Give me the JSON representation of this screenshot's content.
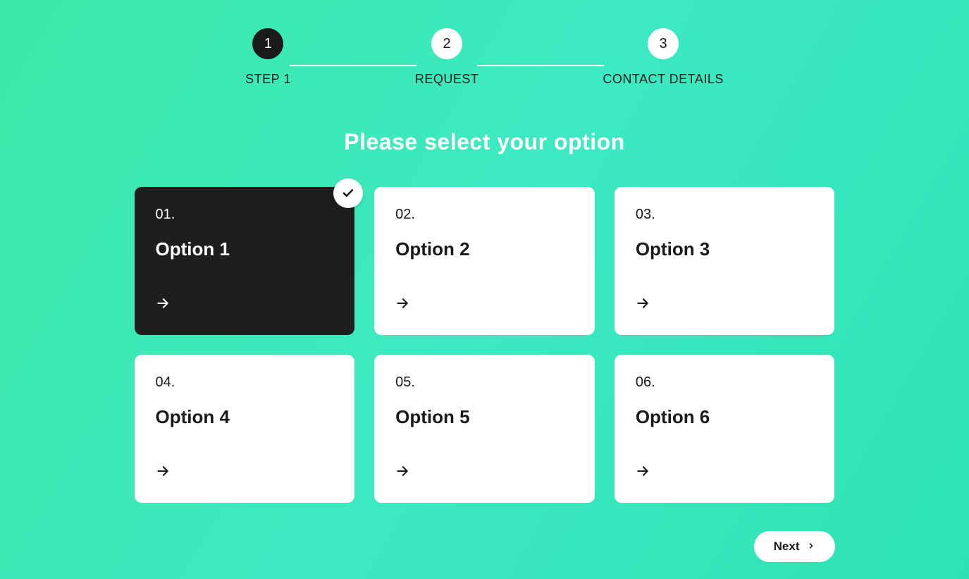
{
  "stepper": {
    "steps": [
      {
        "number": "1",
        "label": "STEP 1",
        "active": true
      },
      {
        "number": "2",
        "label": "REQUEST",
        "active": false
      },
      {
        "number": "3",
        "label": "CONTACT DETAILS",
        "active": false
      }
    ]
  },
  "heading": "Please select your option",
  "options": [
    {
      "number": "01.",
      "title": "Option 1",
      "selected": true
    },
    {
      "number": "02.",
      "title": "Option 2",
      "selected": false
    },
    {
      "number": "03.",
      "title": "Option 3",
      "selected": false
    },
    {
      "number": "04.",
      "title": "Option 4",
      "selected": false
    },
    {
      "number": "05.",
      "title": "Option 5",
      "selected": false
    },
    {
      "number": "06.",
      "title": "Option 6",
      "selected": false
    }
  ],
  "next_button": "Next"
}
